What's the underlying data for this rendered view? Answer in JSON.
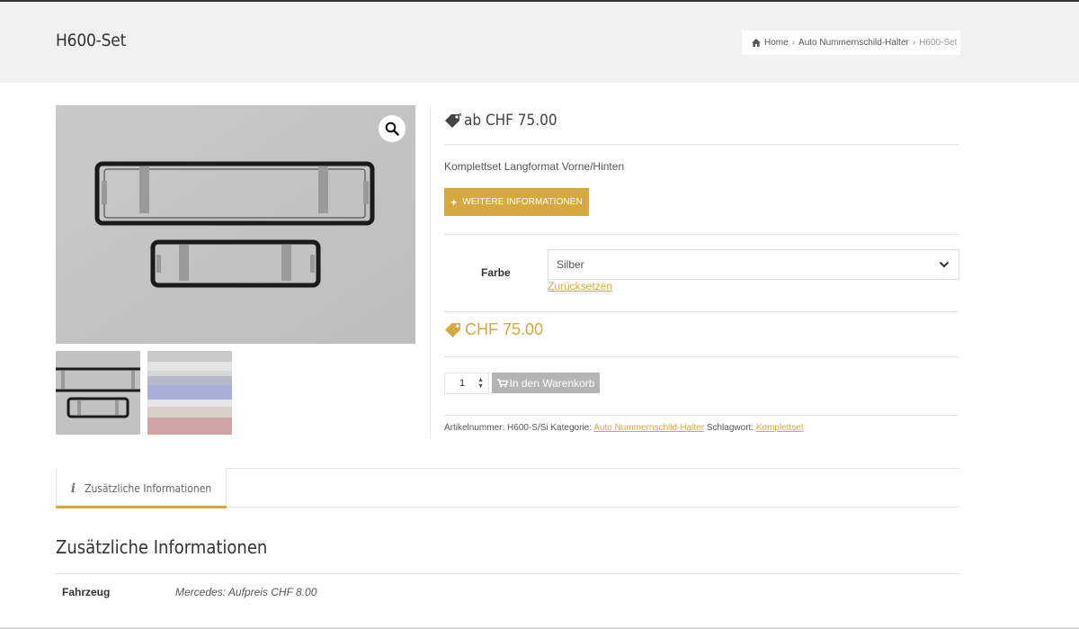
{
  "page": {
    "title": "H600-Set"
  },
  "breadcrumb": {
    "home": "Home",
    "category": "Auto Nummernschild-Halter",
    "current": "H600-Set",
    "separator": "›"
  },
  "icons": {
    "home": "home-icon",
    "zoom": "magnifier-icon",
    "price_tag": "price-tag-icon",
    "plus": "plus-icon",
    "cart": "cart-icon",
    "info": "info-icon",
    "chevron": "chevron-down-icon"
  },
  "summary": {
    "price_from": "ab CHF 75.00",
    "short_description": "Komplettset Langformat Vorne/Hinten",
    "more_info_button": "WEITERE INFORMATIONEN"
  },
  "variation": {
    "label": "Farbe",
    "selected": "Silber",
    "reset_link": "Zurücksetzen"
  },
  "price": "CHF 75.00",
  "cart": {
    "quantity": "1",
    "button": "In den Warenkorb"
  },
  "meta": {
    "sku_label": "Artikelnummer:",
    "sku": "H600-S/Si",
    "category_label": "Kategorie:",
    "category": "Auto Nummernschild-Halter",
    "tag_label": "Schlagwort:",
    "tag": "Komplettset"
  },
  "tabs": [
    {
      "label": "Zusätzliche Informationen"
    }
  ],
  "additional_info": {
    "title": "Zusätzliche Informationen",
    "rows": [
      {
        "name": "Fahrzeug",
        "value": "Mercedes: Aufpreis CHF 8.00"
      }
    ]
  },
  "colors": {
    "accent": "#d6a840",
    "header_bg": "#f1f1f1",
    "cart_button": "#b4b4b4"
  }
}
